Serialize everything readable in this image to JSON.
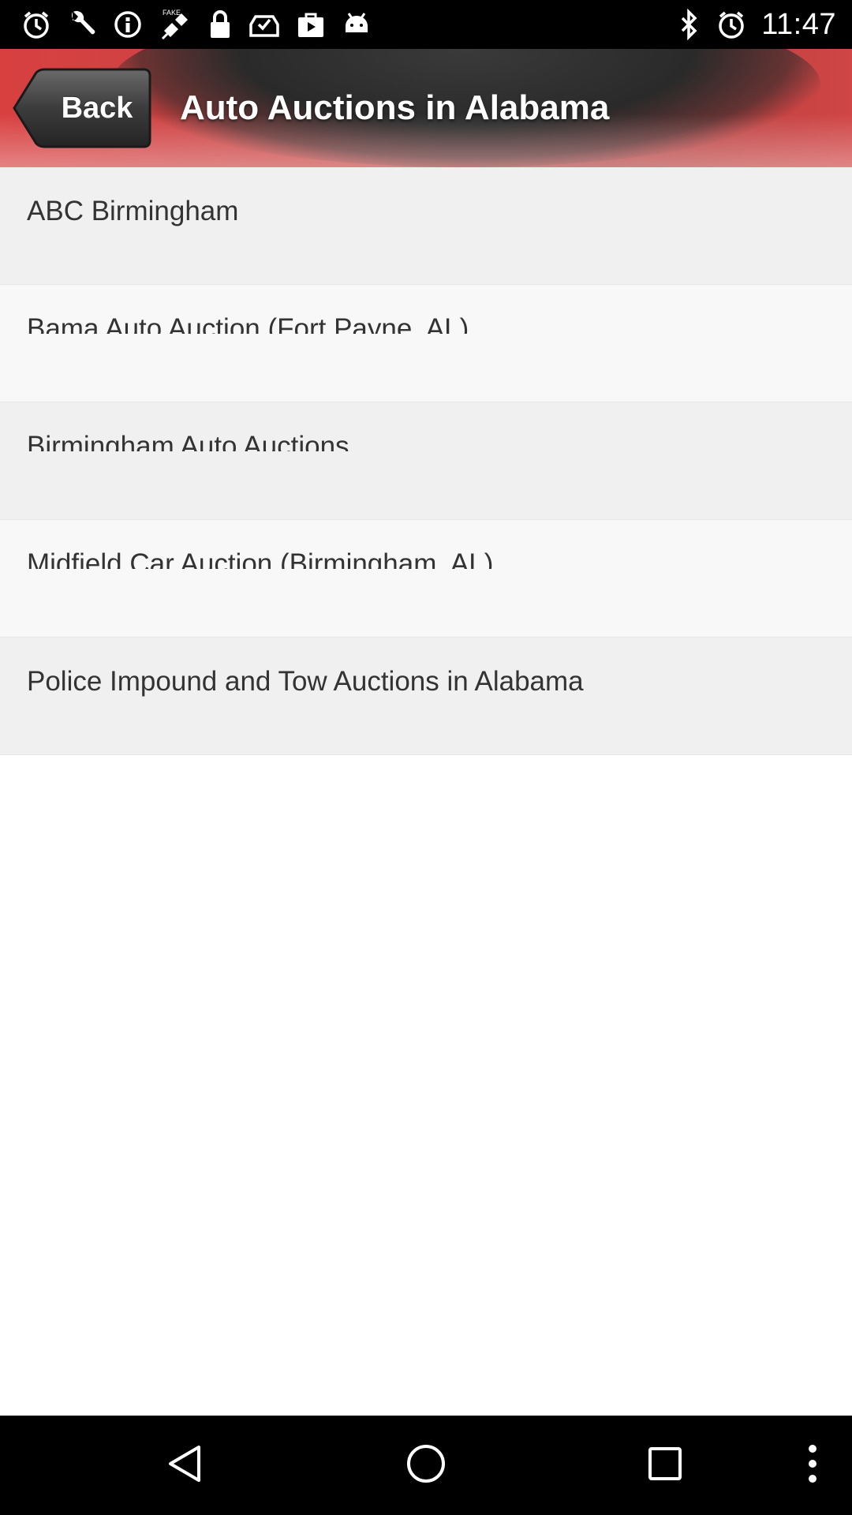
{
  "status_bar": {
    "time": "11:47",
    "left_icons": [
      "alarm-icon",
      "wrench-icon",
      "info-icon",
      "fake-gps-icon",
      "lock-icon",
      "inbox-check-icon",
      "play-bag-icon",
      "android-icon"
    ],
    "right_icons": [
      "bluetooth-icon",
      "alarm-icon"
    ]
  },
  "header": {
    "back_label": "Back",
    "title": "Auto Auctions in Alabama",
    "accent_color": "#c84545"
  },
  "list": {
    "items": [
      {
        "label": "ABC Birmingham"
      },
      {
        "label": "Bama Auto Auction (Fort Payne, AL)"
      },
      {
        "label": "Birmingham Auto Auctions"
      },
      {
        "label": "Midfield Car Auction (Birmingham, AL)"
      },
      {
        "label": "Police Impound and Tow Auctions in Alabama"
      }
    ]
  },
  "nav_bar": {
    "icons": [
      "back-triangle-icon",
      "home-circle-icon",
      "recents-square-icon",
      "more-vert-icon"
    ]
  }
}
